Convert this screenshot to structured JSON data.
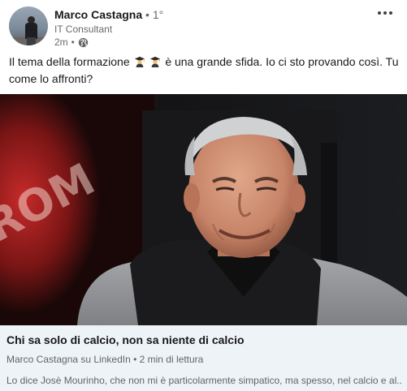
{
  "post": {
    "author_name": "Marco Castagna",
    "connection_degree": "• 1°",
    "author_headline": "IT Consultant",
    "timestamp": "2m",
    "visibility_icon": "globe-icon",
    "text_part1": "Il tema della formazione",
    "text_part2": "è una grande sfida. Io ci sto provando così. Tu come lo affronti?",
    "emoji": [
      "graduate-emoji",
      "graduate-emoji"
    ]
  },
  "article": {
    "image_description": "man-smiling-photo",
    "title": "Chi sa solo di calcio, non sa niente di calcio",
    "meta": "Marco Castagna su LinkedIn • 2 min di lettura",
    "excerpt": "Lo dice Josè Mourinho, che non mi è particolarmente simpatico, ma spesso, nel calcio e al..."
  },
  "colors": {
    "footer_background": "#eef3f8",
    "secondary_text": "#666666"
  }
}
